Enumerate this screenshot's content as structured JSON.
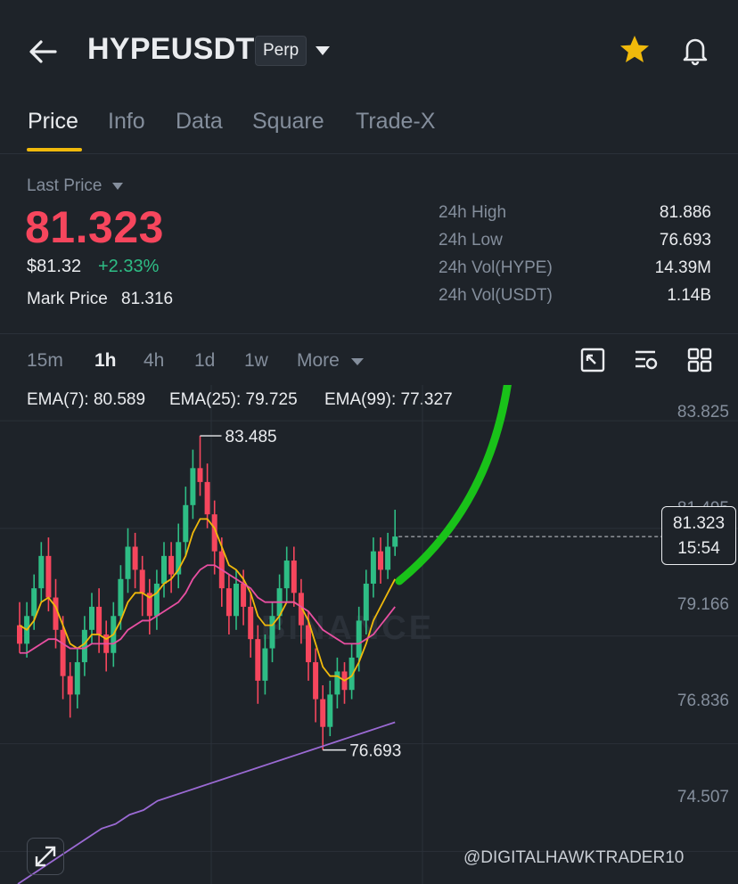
{
  "header": {
    "title": "HYPEUSDT",
    "badge": "Perp"
  },
  "tabs": [
    {
      "label": "Price",
      "active": true
    },
    {
      "label": "Info",
      "active": false
    },
    {
      "label": "Data",
      "active": false
    },
    {
      "label": "Square",
      "active": false
    },
    {
      "label": "Trade-X",
      "active": false
    }
  ],
  "price": {
    "last_price_label": "Last Price",
    "last_price": "81.323",
    "usd_price": "$81.32",
    "change": "+2.33%",
    "mark_price_label": "Mark Price",
    "mark_price": "81.316"
  },
  "stats": [
    {
      "label": "24h High",
      "value": "81.886"
    },
    {
      "label": "24h Low",
      "value": "76.693"
    },
    {
      "label": "24h Vol(HYPE)",
      "value": "14.39M"
    },
    {
      "label": "24h Vol(USDT)",
      "value": "1.14B"
    }
  ],
  "intervals": [
    {
      "label": "15m",
      "active": false
    },
    {
      "label": "1h",
      "active": true
    },
    {
      "label": "4h",
      "active": false
    },
    {
      "label": "1d",
      "active": false
    },
    {
      "label": "1w",
      "active": false
    },
    {
      "label": "More",
      "active": false
    }
  ],
  "ema": [
    {
      "label": "EMA(7): 80.589",
      "color": "#f0b90b"
    },
    {
      "label": "EMA(25): 79.725",
      "color": "#e84fa1"
    },
    {
      "label": "EMA(99): 77.327",
      "color": "#9b6ad4"
    }
  ],
  "chart": {
    "axis_labels": [
      "83.825",
      "81.495",
      "79.166",
      "76.836",
      "74.507"
    ],
    "current_price": "81.323",
    "countdown": "15:54",
    "high_marker": "83.485",
    "low_marker": "76.693",
    "watermark_brand": "BINANCE"
  },
  "watermark": "@DIGITALHAWKTRADER10",
  "colors": {
    "up": "#2ebd85",
    "down": "#f6465d",
    "accent": "#f0b90b",
    "annotation_arrow": "#19c219"
  },
  "chart_data": {
    "type": "candlestick",
    "ylim": [
      73.8,
      84.6
    ],
    "candles": [
      [
        79.4,
        79.0,
        79.9,
        78.8
      ],
      [
        79.0,
        79.6,
        79.9,
        78.7
      ],
      [
        79.6,
        80.2,
        80.5,
        79.3
      ],
      [
        80.2,
        80.9,
        81.2,
        79.9
      ],
      [
        80.9,
        80.0,
        81.3,
        79.7
      ],
      [
        80.0,
        79.3,
        80.4,
        78.9
      ],
      [
        79.3,
        78.3,
        79.6,
        77.8
      ],
      [
        78.3,
        77.9,
        78.6,
        77.4
      ],
      [
        77.9,
        78.6,
        78.9,
        77.6
      ],
      [
        78.6,
        79.3,
        79.6,
        78.3
      ],
      [
        79.3,
        79.8,
        80.1,
        79.0
      ],
      [
        79.8,
        79.2,
        80.2,
        78.8
      ],
      [
        79.2,
        78.8,
        79.5,
        78.4
      ],
      [
        78.8,
        79.6,
        79.9,
        78.5
      ],
      [
        79.6,
        80.4,
        80.7,
        79.3
      ],
      [
        80.4,
        81.1,
        81.5,
        80.1
      ],
      [
        81.1,
        80.6,
        81.4,
        80.2
      ],
      [
        80.6,
        80.1,
        80.9,
        79.6
      ],
      [
        80.1,
        79.6,
        80.4,
        79.2
      ],
      [
        79.6,
        80.3,
        80.6,
        79.3
      ],
      [
        80.3,
        80.9,
        81.2,
        80.0
      ],
      [
        80.9,
        80.5,
        81.2,
        80.1
      ],
      [
        80.5,
        81.2,
        81.6,
        80.2
      ],
      [
        81.2,
        82.0,
        82.4,
        80.9
      ],
      [
        82.0,
        82.8,
        83.2,
        81.7
      ],
      [
        82.8,
        82.5,
        83.5,
        82.2
      ],
      [
        82.5,
        81.8,
        82.9,
        81.5
      ],
      [
        81.8,
        81.0,
        82.1,
        80.5
      ],
      [
        81.0,
        80.2,
        81.3,
        79.8
      ],
      [
        80.2,
        79.6,
        80.5,
        79.2
      ],
      [
        79.6,
        80.3,
        80.6,
        79.3
      ],
      [
        80.3,
        79.8,
        80.6,
        79.4
      ],
      [
        79.8,
        79.1,
        80.1,
        78.7
      ],
      [
        79.1,
        78.2,
        79.4,
        77.7
      ],
      [
        78.2,
        78.9,
        79.2,
        77.9
      ],
      [
        78.9,
        79.6,
        79.9,
        78.6
      ],
      [
        79.6,
        80.2,
        80.5,
        79.3
      ],
      [
        80.2,
        80.8,
        81.1,
        79.9
      ],
      [
        80.8,
        80.1,
        81.1,
        79.8
      ],
      [
        80.1,
        79.4,
        80.4,
        79.0
      ],
      [
        79.4,
        78.6,
        79.7,
        78.2
      ],
      [
        78.6,
        77.8,
        78.9,
        77.3
      ],
      [
        77.8,
        77.2,
        78.1,
        76.7
      ],
      [
        77.2,
        77.9,
        78.2,
        77.0
      ],
      [
        77.9,
        78.4,
        78.7,
        77.6
      ],
      [
        78.4,
        78.0,
        78.6,
        77.7
      ],
      [
        78.0,
        78.7,
        79.0,
        77.8
      ],
      [
        78.7,
        79.5,
        79.8,
        78.4
      ],
      [
        79.5,
        80.3,
        80.6,
        79.2
      ],
      [
        80.3,
        81.0,
        81.3,
        80.0
      ],
      [
        81.0,
        80.6,
        81.3,
        80.3
      ],
      [
        80.6,
        81.1,
        81.4,
        80.4
      ],
      [
        81.1,
        81.32,
        81.9,
        80.9
      ]
    ],
    "ema7": [
      79.4,
      79.3,
      79.5,
      79.9,
      80.0,
      79.8,
      79.4,
      79.0,
      78.9,
      79.0,
      79.2,
      79.2,
      79.1,
      79.2,
      79.5,
      79.9,
      80.1,
      80.1,
      80.0,
      80.1,
      80.3,
      80.4,
      80.6,
      80.9,
      81.4,
      81.7,
      81.7,
      81.5,
      81.1,
      80.7,
      80.6,
      80.4,
      80.1,
      79.6,
      79.4,
      79.4,
      79.6,
      79.9,
      79.9,
      79.8,
      79.5,
      79.0,
      78.5,
      78.3,
      78.3,
      78.2,
      78.3,
      78.6,
      79.0,
      79.5,
      79.8,
      80.1,
      80.4
    ],
    "ema25": [
      78.8,
      78.8,
      78.9,
      79.0,
      79.1,
      79.1,
      79.0,
      78.9,
      78.9,
      78.9,
      79.0,
      79.0,
      79.0,
      79.0,
      79.1,
      79.3,
      79.4,
      79.5,
      79.5,
      79.6,
      79.7,
      79.8,
      79.9,
      80.1,
      80.4,
      80.6,
      80.7,
      80.7,
      80.6,
      80.5,
      80.4,
      80.3,
      80.2,
      80.0,
      79.9,
      79.9,
      79.9,
      79.9,
      79.9,
      79.8,
      79.7,
      79.5,
      79.3,
      79.2,
      79.1,
      79.0,
      79.0,
      79.0,
      79.1,
      79.2,
      79.4,
      79.6,
      79.8
    ],
    "ema99": [
      73.8,
      74.0,
      74.2,
      74.4,
      74.6,
      74.8,
      75.0,
      75.1,
      75.3,
      75.4,
      75.6,
      75.7,
      75.8,
      75.9,
      76.0,
      76.1,
      76.2,
      76.3,
      76.4,
      76.5,
      76.6,
      76.7,
      76.8,
      76.9,
      77.0,
      77.1,
      77.2,
      77.3
    ]
  }
}
